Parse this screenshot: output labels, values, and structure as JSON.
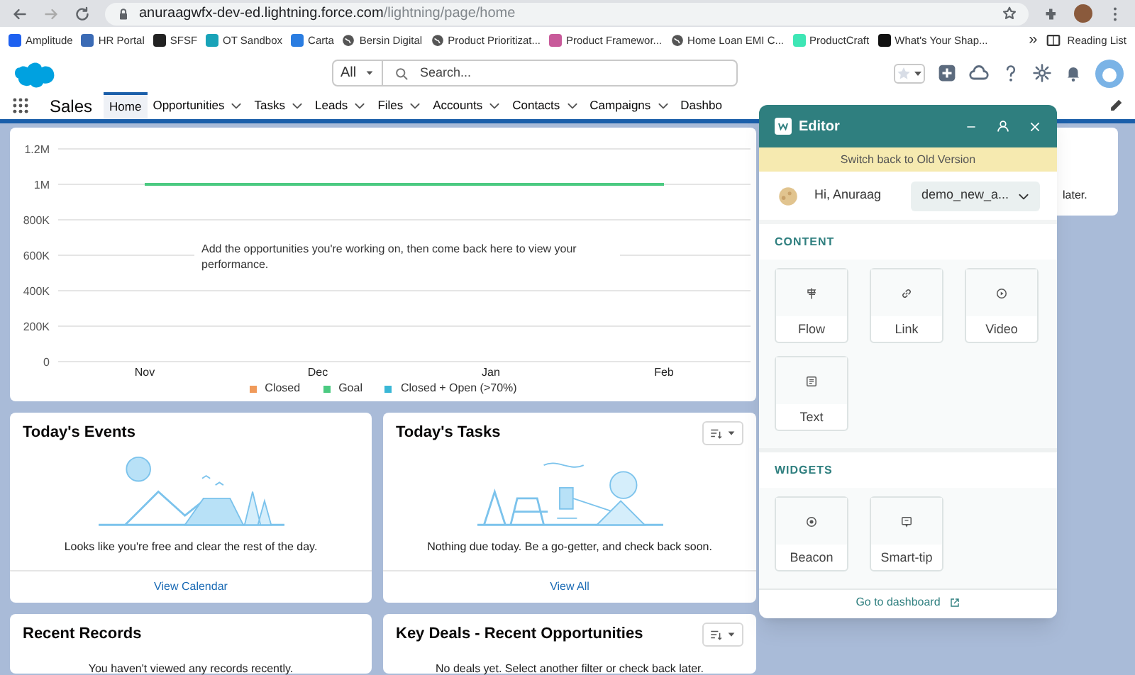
{
  "browser": {
    "url_host": "anuraagwfx-dev-ed.lightning.force.com",
    "url_path": "/lightning/page/home",
    "bookmarks": [
      {
        "label": "Amplitude",
        "kind": "favicon",
        "color": "#1e61f0"
      },
      {
        "label": "HR Portal",
        "kind": "favicon",
        "color": "#3b6bb5"
      },
      {
        "label": "SFSF",
        "kind": "favicon",
        "color": "#222222"
      },
      {
        "label": "OT Sandbox",
        "kind": "favicon",
        "color": "#19a3b8"
      },
      {
        "label": "Carta",
        "kind": "favicon",
        "color": "#2a7de1"
      },
      {
        "label": "Bersin Digital",
        "kind": "globe"
      },
      {
        "label": "Product Prioritizat...",
        "kind": "globe"
      },
      {
        "label": "Product Framewor...",
        "kind": "favicon",
        "color": "#c85a9a"
      },
      {
        "label": "Home Loan EMI C...",
        "kind": "globe"
      },
      {
        "label": "ProductCraft",
        "kind": "favicon",
        "color": "#3ee6b5"
      },
      {
        "label": "What's Your Shap...",
        "kind": "favicon",
        "color": "#111111"
      }
    ],
    "more": "»",
    "reading_list": "Reading List"
  },
  "header": {
    "search_scope": "All",
    "search_placeholder": "Search..."
  },
  "nav": {
    "app_name": "Sales",
    "tabs": [
      {
        "label": "Home",
        "selected": true,
        "menu": false
      },
      {
        "label": "Opportunities",
        "selected": false,
        "menu": true
      },
      {
        "label": "Tasks",
        "selected": false,
        "menu": true
      },
      {
        "label": "Leads",
        "selected": false,
        "menu": true
      },
      {
        "label": "Files",
        "selected": false,
        "menu": true
      },
      {
        "label": "Accounts",
        "selected": false,
        "menu": true
      },
      {
        "label": "Contacts",
        "selected": false,
        "menu": true
      },
      {
        "label": "Campaigns",
        "selected": false,
        "menu": true
      },
      {
        "label": "Dashbo",
        "selected": false,
        "menu": false
      }
    ]
  },
  "performance": {
    "message": "Add the opportunities you're working on, then come back here to view your performance.",
    "chart_data": {
      "type": "line",
      "categories": [
        "Nov",
        "Dec",
        "Jan",
        "Feb"
      ],
      "series": [
        {
          "name": "Closed",
          "color": "#f09a5a",
          "values": [
            null,
            null,
            null,
            null
          ]
        },
        {
          "name": "Goal",
          "color": "#4bca81",
          "values": [
            1000000,
            1000000,
            1000000,
            1000000
          ]
        },
        {
          "name": "Closed + Open (>70%)",
          "color": "#3ab7d6",
          "values": [
            null,
            null,
            null,
            null
          ]
        }
      ],
      "ylim": [
        0,
        1200000
      ],
      "grid": true,
      "yticks": [
        {
          "value": 0,
          "label": "0"
        },
        {
          "value": 200000,
          "label": "200K"
        },
        {
          "value": 400000,
          "label": "400K"
        },
        {
          "value": 600000,
          "label": "600K"
        },
        {
          "value": 800000,
          "label": "800K"
        },
        {
          "value": 1000000,
          "label": "1M"
        },
        {
          "value": 1200000,
          "label": "1.2M"
        }
      ]
    }
  },
  "cards": [
    {
      "title": "Today's Events",
      "filter_menu": false,
      "illustration": true,
      "message": "Looks like you're free and clear the rest of the day.",
      "link": "View Calendar"
    },
    {
      "title": "Today's Tasks",
      "filter_menu": true,
      "illustration": true,
      "message": "Nothing due today. Be a go-getter, and check back soon.",
      "link": "View All"
    },
    {
      "title": "Recent Records",
      "filter_menu": false,
      "illustration": false,
      "message": "You haven't viewed any records recently."
    },
    {
      "title": "Key Deals - Recent Opportunities",
      "filter_menu": true,
      "illustration": false,
      "message": "No deals yet. Select another filter or check back later."
    }
  ],
  "side_card": {
    "text": "later."
  },
  "editor": {
    "title": "Editor",
    "banner": "Switch back to Old Version",
    "greeting": "Hi, Anuraag",
    "workspace": "demo_new_a...",
    "sections": [
      {
        "title": "CONTENT",
        "items": [
          {
            "label": "Flow",
            "kind": "flow"
          },
          {
            "label": "Link",
            "kind": "link"
          },
          {
            "label": "Video",
            "kind": "video"
          },
          {
            "label": "Text",
            "kind": "text"
          }
        ]
      },
      {
        "title": "WIDGETS",
        "items": [
          {
            "label": "Beacon",
            "kind": "beacon"
          },
          {
            "label": "Smart-tip",
            "kind": "smart-tip"
          }
        ]
      }
    ],
    "footer_link": "Go to dashboard"
  }
}
